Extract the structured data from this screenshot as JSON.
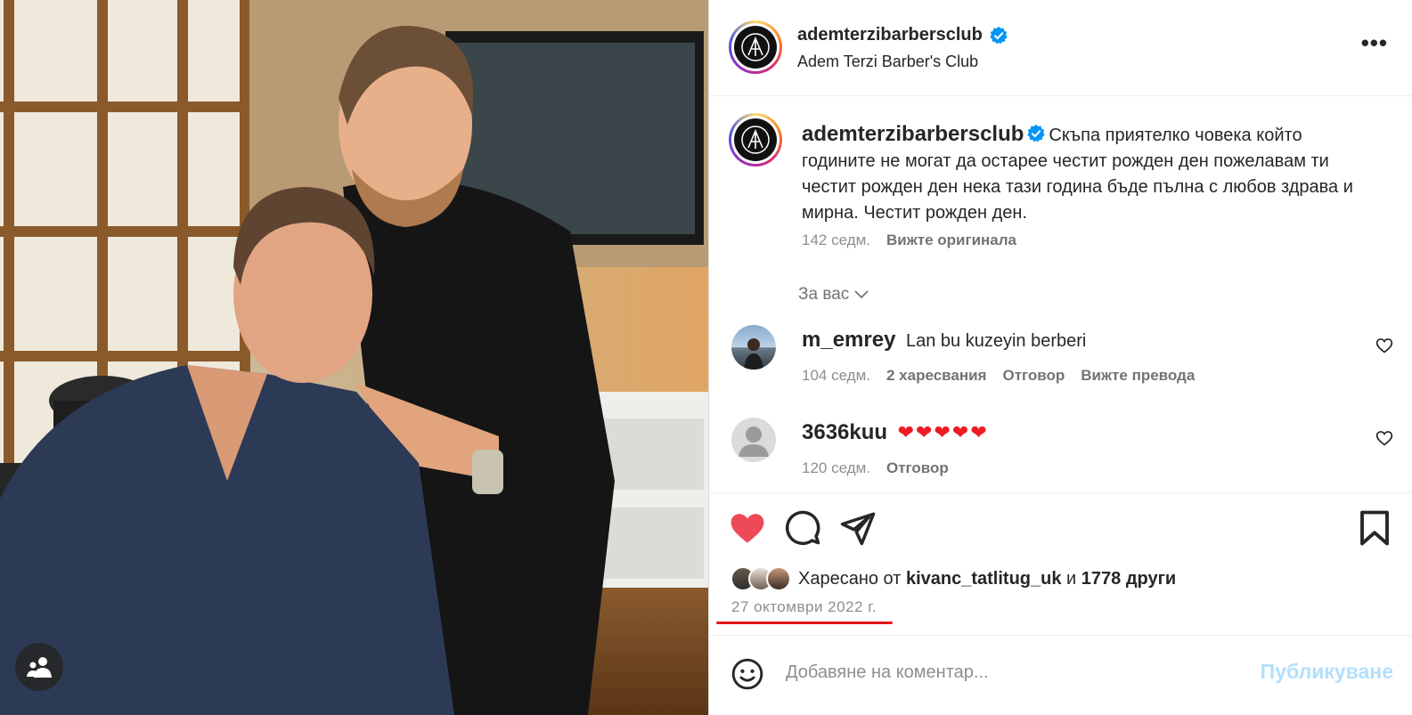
{
  "post": {
    "account": "ademterzibarbersclub",
    "account_fullname": "Adem Terzi Barber's Club",
    "caption_user": "ademterzibarbersclub",
    "caption_text": "Скъпа приятелко човека който годините не могат да остарее честит рожден ден пожелавам ти честит рожден ден нека тази година бъде пълна с любов здрава и мирна. Честит рожден ден.",
    "caption_age": "142 седм.",
    "caption_see_original": "Вижте оригинала",
    "for_you": "За вас",
    "date": "27 октомври 2022 г."
  },
  "comments": [
    {
      "user": "m_emrey",
      "text": "Lan bu kuzeyin berberi",
      "age": "104 седм.",
      "likes": "2 харесвания",
      "reply": "Отговор",
      "translate": "Вижте превода"
    },
    {
      "user": "3636kuu",
      "text": "❤❤❤❤❤",
      "age": "120 седм.",
      "reply": "Отговор"
    }
  ],
  "likes": {
    "prefix": "Харесано от",
    "user": "kivanc_tatlitug_uk",
    "and": "и",
    "others": "1778 други"
  },
  "add_comment": {
    "placeholder": "Добавяне на коментар...",
    "post_label": "Публикуване"
  },
  "colors": {
    "like_red": "#ed4956",
    "verified_blue": "#0095f6",
    "annotation_red": "#e4161b"
  },
  "icons": [
    "user-tag-icon",
    "more-icon",
    "verified-icon",
    "chevron-down-icon",
    "heart-outline-icon",
    "heart-filled-icon",
    "comment-icon",
    "share-icon",
    "bookmark-icon",
    "emoji-icon"
  ]
}
